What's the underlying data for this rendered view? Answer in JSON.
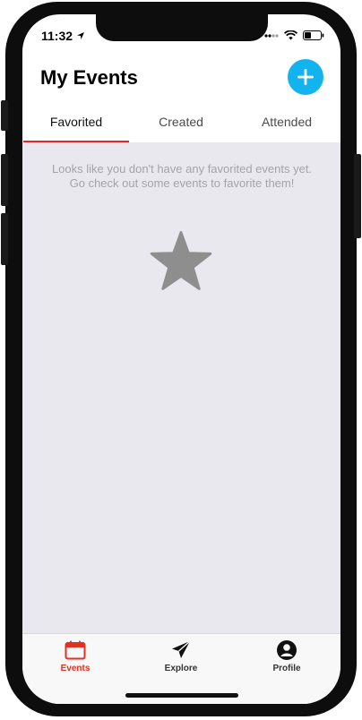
{
  "status_bar": {
    "time": "11:32"
  },
  "header": {
    "title": "My Events",
    "add_button_icon": "plus-icon"
  },
  "tabs": [
    {
      "label": "Favorited",
      "active": true
    },
    {
      "label": "Created",
      "active": false
    },
    {
      "label": "Attended",
      "active": false
    }
  ],
  "empty_state": {
    "message": "Looks like you don't have any favorited events yet. Go check out some events to favorite them!",
    "icon": "star-icon"
  },
  "tabbar": {
    "items": [
      {
        "label": "Events",
        "icon": "calendar-icon",
        "active": true
      },
      {
        "label": "Explore",
        "icon": "paper-plane-icon",
        "active": false
      },
      {
        "label": "Profile",
        "icon": "person-icon",
        "active": false
      }
    ]
  },
  "colors": {
    "accent_red": "#e8232a",
    "add_button_blue": "#12b3ee",
    "content_background": "#e9e8ee",
    "empty_text": "#a3a3a8",
    "star": "#8e8e8e"
  }
}
